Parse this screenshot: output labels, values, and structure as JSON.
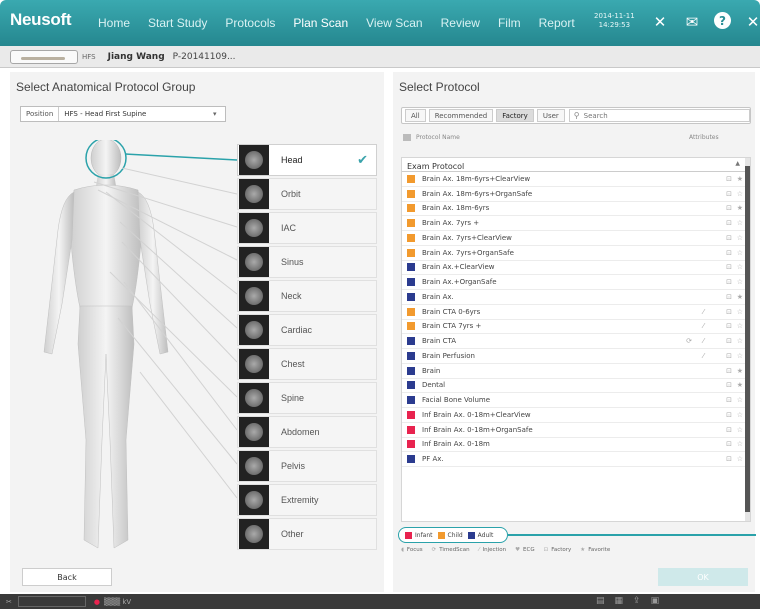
{
  "app": {
    "logo": "Neusoft",
    "nav": [
      "Home",
      "Start Study",
      "Protocols",
      "Plan Scan",
      "View Scan",
      "Review",
      "Film",
      "Report"
    ],
    "active_nav": "Plan Scan",
    "date": "2014-11-11",
    "time": "14:29:53",
    "icons": [
      "tools-icon",
      "mail-icon",
      "help-icon",
      "close-icon"
    ],
    "help_label": "?",
    "accent": "#2a959d"
  },
  "patient": {
    "position": "HFS",
    "name": "Jiang Wang",
    "id": "P-20141109..."
  },
  "left_panel": {
    "title": "Select Anatomical Protocol Group",
    "position_label": "Position",
    "position_value": "HFS - Head First Supine",
    "regions": [
      {
        "label": "Head",
        "selected": true
      },
      {
        "label": "Orbit"
      },
      {
        "label": "IAC"
      },
      {
        "label": "Sinus"
      },
      {
        "label": "Neck"
      },
      {
        "label": "Cardiac"
      },
      {
        "label": "Chest"
      },
      {
        "label": "Spine"
      },
      {
        "label": "Abdomen"
      },
      {
        "label": "Pelvis"
      },
      {
        "label": "Extremity"
      },
      {
        "label": "Other"
      }
    ],
    "back_label": "Back"
  },
  "right_panel": {
    "title": "Select Protocol",
    "filters": [
      "All",
      "Recommended",
      "Factory",
      "User"
    ],
    "active_filter": "Factory",
    "search_placeholder": "Search",
    "col_protocol": "Protocol Name",
    "col_attributes": "Attributes",
    "group_name": "Exam Protocol",
    "protocols": [
      {
        "name": "Brain Ax. 18m-6yrs+ClearView",
        "cat": "child",
        "fav": true
      },
      {
        "name": "Brain Ax. 18m-6yrs+OrganSafe",
        "cat": "child",
        "fav": false
      },
      {
        "name": "Brain Ax. 18m-6yrs",
        "cat": "child",
        "fav": true
      },
      {
        "name": "Brain Ax. 7yrs +",
        "cat": "child",
        "fav": false
      },
      {
        "name": "Brain Ax. 7yrs+ClearView",
        "cat": "child",
        "fav": false
      },
      {
        "name": "Brain Ax. 7yrs+OrganSafe",
        "cat": "child",
        "fav": false
      },
      {
        "name": "Brain Ax.+ClearView",
        "cat": "adult",
        "fav": false
      },
      {
        "name": "Brain Ax.+OrganSafe",
        "cat": "adult",
        "fav": false
      },
      {
        "name": "Brain Ax.",
        "cat": "adult",
        "fav": true
      },
      {
        "name": "Brain CTA 0-6yrs",
        "cat": "child",
        "fav": false,
        "injection": true
      },
      {
        "name": "Brain CTA 7yrs +",
        "cat": "child",
        "fav": false,
        "injection": true
      },
      {
        "name": "Brain CTA",
        "cat": "adult",
        "fav": false,
        "injection": true,
        "timed": true
      },
      {
        "name": "Brain Perfusion",
        "cat": "adult",
        "fav": false,
        "injection": true
      },
      {
        "name": "Brain",
        "cat": "adult",
        "fav": true
      },
      {
        "name": "Dental",
        "cat": "adult",
        "fav": true
      },
      {
        "name": "Facial Bone Volume",
        "cat": "adult",
        "fav": false
      },
      {
        "name": "Inf Brain Ax. 0-18m+ClearView",
        "cat": "infant",
        "fav": false
      },
      {
        "name": "Inf Brain Ax. 0-18m+OrganSafe",
        "cat": "infant",
        "fav": false
      },
      {
        "name": "Inf Brain Ax. 0-18m",
        "cat": "infant",
        "fav": false
      },
      {
        "name": "PF Ax.",
        "cat": "adult",
        "fav": false
      }
    ],
    "colors": {
      "infant": "#e8234f",
      "child": "#f29a2e",
      "adult": "#2b3b8f"
    },
    "legend": [
      {
        "label": "Infant",
        "cat": "infant"
      },
      {
        "label": "Child",
        "cat": "child"
      },
      {
        "label": "Adult",
        "cat": "adult"
      }
    ],
    "attributes": [
      {
        "icon": "focus-icon",
        "label": "Focus"
      },
      {
        "icon": "timed-scan-icon",
        "label": "TimedScan"
      },
      {
        "icon": "injection-icon",
        "label": "Injection"
      },
      {
        "icon": "ecg-icon",
        "label": "ECG"
      },
      {
        "icon": "lock-icon",
        "label": "Factory"
      },
      {
        "icon": "star-icon",
        "label": "Favorite"
      }
    ],
    "ok_label": "OK"
  },
  "bottom": {
    "info": "▒▒▒ kV"
  }
}
